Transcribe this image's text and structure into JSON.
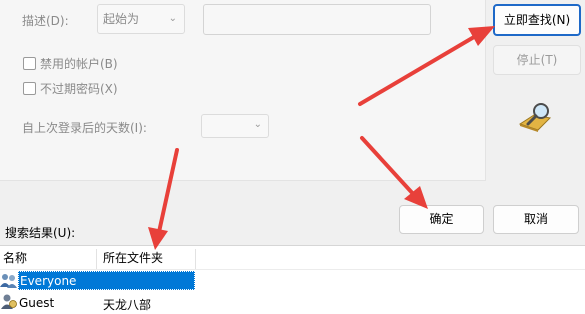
{
  "query": {
    "description_label": "描述(D):",
    "description_match": "起始为",
    "disabled_accounts_label": "禁用的帐户(B)",
    "non_expiring_passwords_label": "不过期密码(X)",
    "days_since_logon_label": "自上次登录后的天数(I):"
  },
  "buttons": {
    "find_now": "立即查找(N)",
    "stop": "停止(T)",
    "ok": "确定",
    "cancel": "取消"
  },
  "results": {
    "label": "搜索结果(U):",
    "columns": [
      "名称",
      "所在文件夹"
    ],
    "rows": [
      {
        "name": "Everyone",
        "folder": "",
        "selected": true
      },
      {
        "name": "Guest",
        "folder": "天龙八部",
        "selected": false
      }
    ]
  },
  "colors": {
    "arrow": "#e8403a",
    "selection": "#0078d7",
    "primary_border": "#1e69c8"
  }
}
